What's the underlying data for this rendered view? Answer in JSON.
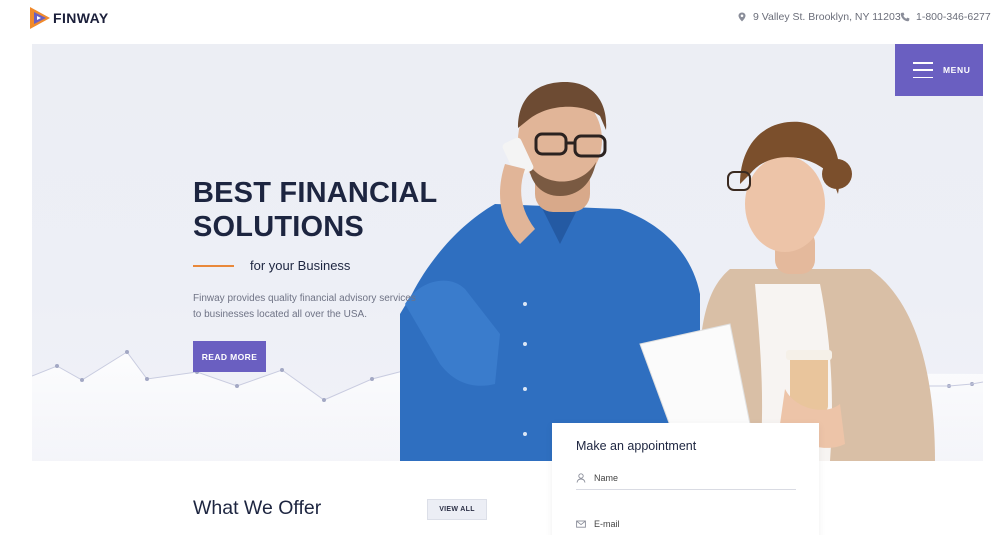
{
  "brand": {
    "name": "FINWAY",
    "colors": {
      "primary": "#6a5fc1",
      "accent": "#e9883a",
      "dark": "#1d2540"
    }
  },
  "header": {
    "address": "9 Valley St. Brooklyn, NY 11203",
    "phone": "1-800-346-6277",
    "address_icon": "location-pin-icon",
    "phone_icon": "phone-icon"
  },
  "menu": {
    "label": "MENU",
    "icon": "hamburger-icon"
  },
  "hero": {
    "title_line1": "BEST FINANCIAL",
    "title_line2": "SOLUTIONS",
    "subtitle": "for your Business",
    "description": "Finway provides quality financial advisory services to businesses located all over the USA.",
    "button": "READ MORE"
  },
  "appointment": {
    "title": "Make an appointment",
    "name_placeholder": "Name",
    "email_placeholder": "E-mail",
    "name_icon": "user-icon",
    "email_icon": "mail-icon"
  },
  "offer": {
    "title": "What We Offer",
    "button": "VIEW ALL"
  }
}
